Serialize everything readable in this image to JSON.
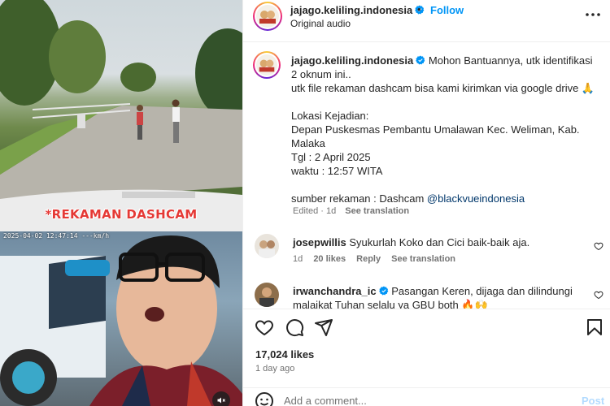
{
  "media": {
    "overlay_title": "*REKAMAN DASHCAM",
    "timestamp": "2025-04-02 12:47:14 ---km/h"
  },
  "header": {
    "username": "jajago.keliling.indonesia",
    "separator": "•",
    "follow_label": "Follow",
    "audio_label": "Original audio"
  },
  "caption": {
    "username": "jajago.keliling.indonesia",
    "lines": [
      "Mohon Bantuannya, utk identifikasi 2 oknum ini..",
      "utk file rekaman dashcam bisa kami kirimkan via google drive 🙏",
      "",
      "Lokasi Kejadian:",
      "Depan Puskesmas Pembantu Umalawan Kec. Weliman, Kab. Malaka",
      "Tgl : 2 April 2025",
      "waktu : 12:57 WITA",
      "",
      "sumber rekaman : Dashcam"
    ],
    "mention": "@blackvueindonesia",
    "edited": "Edited · 1d",
    "see_translation": "See translation"
  },
  "comments": [
    {
      "username": "josepwillis",
      "text": "Syukurlah Koko dan Cici baik-baik aja.",
      "age": "1d",
      "likes": "20 likes",
      "reply": "Reply",
      "see_translation": "See translation"
    },
    {
      "username": "irwanchandra_ic",
      "text": "Pasangan Keren, dijaga dan dilindungi malaikat Tuhan selalu ya GBU both 🔥🙌"
    }
  ],
  "footer": {
    "likes": "17,024 likes",
    "time_ago": "1 day ago",
    "add_comment_placeholder": "Add a comment...",
    "post_label": "Post"
  },
  "colors": {
    "accent": "#0095f6",
    "mention": "#00376b",
    "muted": "#737373",
    "dashcam_red": "#e53935"
  },
  "icons": [
    "verified-badge-icon",
    "more-options-icon",
    "heart-icon",
    "comment-icon",
    "share-icon",
    "bookmark-icon",
    "emoji-icon",
    "mute-icon"
  ]
}
